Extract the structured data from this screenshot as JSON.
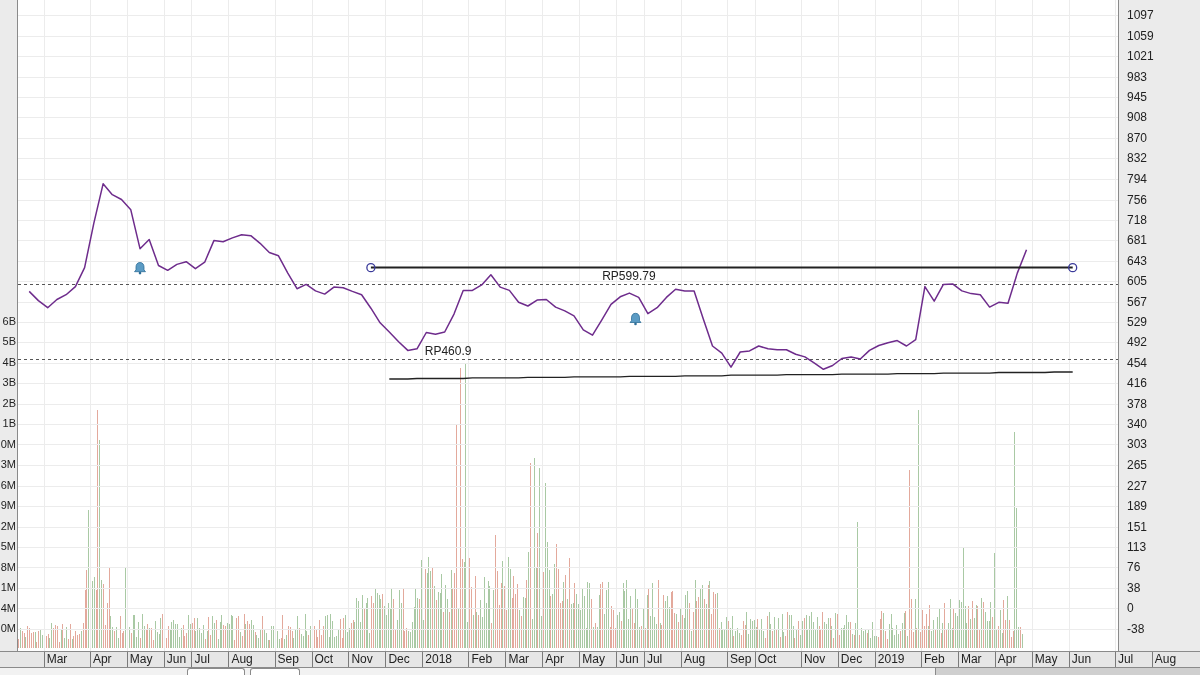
{
  "chart": {
    "volume_axis": {
      "labels": [
        "6B",
        "5B",
        "4B",
        "3B",
        "2B",
        "1B",
        "0M",
        "3M",
        "6M",
        "9M",
        "2M",
        "5M",
        "8M",
        "1M",
        "4M",
        "0M"
      ]
    },
    "chart_data": {
      "type": "line",
      "grid": true,
      "categories": [
        null,
        null,
        null,
        "Mar",
        null,
        null,
        null,
        null,
        "Apr",
        null,
        null,
        null,
        "May",
        null,
        null,
        null,
        "Jun",
        null,
        null,
        "Jul",
        null,
        null,
        null,
        "Aug",
        null,
        null,
        null,
        null,
        "Sep",
        null,
        null,
        null,
        "Oct",
        null,
        null,
        null,
        "Nov",
        null,
        null,
        null,
        "Dec",
        null,
        null,
        null,
        "2018",
        null,
        null,
        null,
        null,
        "Feb",
        null,
        null,
        null,
        "Mar",
        null,
        null,
        null,
        "Apr",
        null,
        null,
        null,
        "May",
        null,
        null,
        null,
        "Jun",
        null,
        null,
        "Jul",
        null,
        null,
        null,
        "Aug",
        null,
        null,
        null,
        null,
        "Sep",
        null,
        null,
        "Oct",
        null,
        null,
        null,
        null,
        "Nov",
        null,
        null,
        null,
        "Dec",
        null,
        null,
        null,
        "2019",
        null,
        null,
        null,
        null,
        "Feb",
        null,
        null,
        null,
        "Mar",
        null,
        null,
        null,
        "Apr",
        null,
        null,
        null,
        "May",
        null,
        null,
        null,
        "Jun",
        null,
        null,
        null,
        null,
        "Jul",
        null,
        null,
        null,
        "Aug",
        null,
        null,
        null,
        null
      ],
      "ylim": [
        -79,
        1125
      ],
      "yticks": [
        1097,
        1059,
        1021,
        983,
        945,
        908,
        870,
        832,
        794,
        756,
        718,
        681,
        643,
        605,
        567,
        529,
        492,
        454,
        416,
        378,
        340,
        303,
        265,
        227,
        189,
        151,
        113,
        76,
        38,
        0,
        -38
      ],
      "series": [
        {
          "color": "#6e2c8c",
          "values": [
            586,
            569,
            556,
            571,
            580,
            595,
            630,
            712,
            785,
            765,
            756,
            737,
            665,
            682,
            634,
            625,
            636,
            641,
            628,
            640,
            680,
            678,
            685,
            691,
            689,
            675,
            658,
            652,
            620,
            591,
            599,
            587,
            581,
            594,
            593,
            586,
            580,
            555,
            528,
            511,
            493,
            477,
            480,
            510,
            507,
            511,
            544,
            588,
            588,
            598,
            617,
            594,
            588,
            566,
            559,
            570,
            571,
            557,
            550,
            541,
            515,
            505,
            533,
            562,
            576,
            583,
            575,
            545,
            556,
            575,
            590,
            587,
            587,
            535,
            485,
            472,
            446,
            474,
            476,
            485,
            480,
            478,
            478,
            470,
            465,
            454,
            442,
            449,
            462,
            465,
            461,
            477,
            486,
            491,
            495,
            485,
            497,
            595,
            568,
            599,
            600,
            587,
            582,
            580,
            557,
            566,
            564,
            620,
            663,
            null,
            null,
            null,
            null,
            null,
            null,
            null,
            null,
            null,
            null,
            null,
            null,
            null,
            null,
            null,
            null,
            null,
            null,
            null
          ]
        },
        {
          "color": "#222222",
          "values": [
            null,
            null,
            null,
            null,
            null,
            null,
            null,
            null,
            null,
            null,
            null,
            null,
            null,
            null,
            null,
            null,
            null,
            null,
            null,
            null,
            null,
            null,
            null,
            null,
            null,
            null,
            null,
            null,
            null,
            null,
            null,
            null,
            null,
            null,
            null,
            null,
            null,
            630,
            630,
            630,
            630,
            630,
            630,
            630,
            630,
            630,
            630,
            630,
            630,
            630,
            630,
            630,
            630,
            630,
            630,
            630,
            630,
            630,
            630,
            630,
            630,
            630,
            630,
            630,
            630,
            630,
            630,
            630,
            630,
            630,
            630,
            630,
            630,
            630,
            630,
            630,
            630,
            630,
            630,
            630,
            630,
            630,
            630,
            630,
            630,
            630,
            630,
            630,
            630,
            630,
            630,
            630,
            630,
            630,
            630,
            630,
            630,
            630,
            630,
            630,
            630,
            630,
            630,
            630,
            630,
            630,
            630,
            630,
            630,
            630,
            630,
            630,
            630,
            630,
            null,
            null,
            null,
            null,
            null,
            null,
            null,
            null,
            null,
            null,
            null,
            null,
            null,
            null
          ]
        },
        {
          "color": "#222222",
          "values": [
            null,
            null,
            null,
            null,
            null,
            null,
            null,
            null,
            null,
            null,
            null,
            null,
            null,
            null,
            null,
            null,
            null,
            null,
            null,
            null,
            null,
            null,
            null,
            null,
            null,
            null,
            null,
            null,
            null,
            null,
            null,
            null,
            null,
            null,
            null,
            null,
            null,
            null,
            null,
            424,
            424,
            424,
            425,
            425,
            425,
            425,
            425,
            425,
            426,
            426,
            426,
            426,
            426,
            426,
            427,
            427,
            427,
            427,
            427,
            428,
            428,
            428,
            428,
            428,
            428,
            429,
            429,
            429,
            429,
            429,
            429,
            430,
            430,
            430,
            430,
            430,
            431,
            431,
            431,
            431,
            431,
            431,
            432,
            432,
            432,
            432,
            432,
            432,
            433,
            433,
            433,
            433,
            433,
            433,
            434,
            434,
            434,
            434,
            434,
            435,
            435,
            435,
            435,
            435,
            435,
            436,
            436,
            436,
            436,
            436,
            436,
            437,
            437,
            437,
            null,
            null,
            null,
            null,
            null,
            null,
            null,
            null,
            null,
            null,
            null,
            null,
            null,
            null
          ]
        }
      ],
      "ref_lines": [
        {
          "axis": "y",
          "value": 599.79,
          "label": "RP599.79"
        },
        {
          "axis": "y",
          "value": 460.9,
          "label": "RP460.9"
        }
      ]
    },
    "drawings": [
      {
        "kind": "trendline",
        "selected": true
      },
      {
        "kind": "trendline",
        "selected": false
      },
      {
        "kind": "alert"
      },
      {
        "kind": "alert"
      }
    ]
  }
}
